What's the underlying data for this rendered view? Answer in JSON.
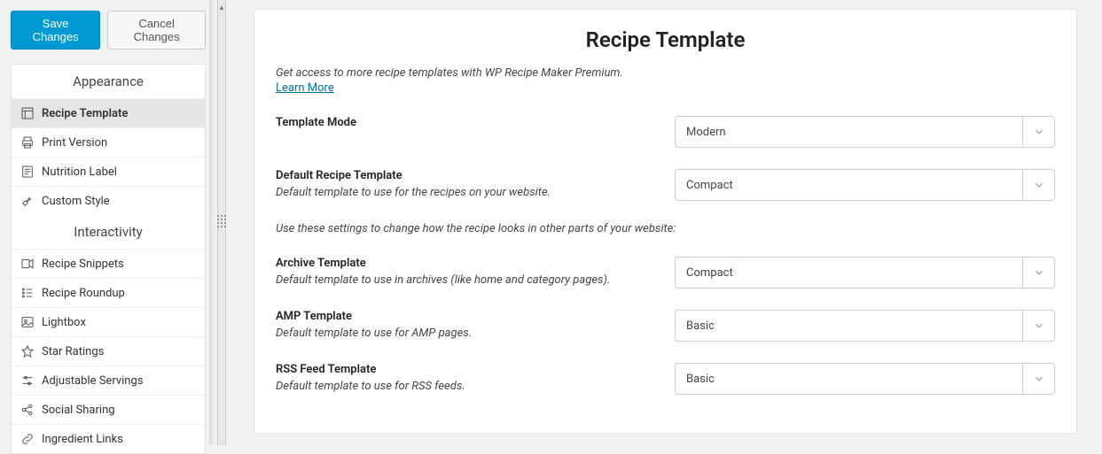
{
  "buttons": {
    "save": "Save Changes",
    "cancel": "Cancel Changes"
  },
  "sidebar": {
    "section_appearance": "Appearance",
    "section_interactivity": "Interactivity",
    "appearance_items": [
      {
        "label": "Recipe Template"
      },
      {
        "label": "Print Version"
      },
      {
        "label": "Nutrition Label"
      },
      {
        "label": "Custom Style"
      }
    ],
    "interactivity_items": [
      {
        "label": "Recipe Snippets"
      },
      {
        "label": "Recipe Roundup"
      },
      {
        "label": "Lightbox"
      },
      {
        "label": "Star Ratings"
      },
      {
        "label": "Adjustable Servings"
      },
      {
        "label": "Social Sharing"
      },
      {
        "label": "Ingredient Links"
      }
    ]
  },
  "main": {
    "title": "Recipe Template",
    "promo": "Get access to more recipe templates with WP Recipe Maker Premium.",
    "learn_more": "Learn More",
    "intersettings_note": "Use these settings to change how the recipe looks in other parts of your website:",
    "fields": {
      "template_mode": {
        "label": "Template Mode",
        "value": "Modern"
      },
      "default_template": {
        "label": "Default Recipe Template",
        "desc": "Default template to use for the recipes on your website.",
        "value": "Compact"
      },
      "archive_template": {
        "label": "Archive Template",
        "desc": "Default template to use in archives (like home and category pages).",
        "value": "Compact"
      },
      "amp_template": {
        "label": "AMP Template",
        "desc": "Default template to use for AMP pages.",
        "value": "Basic"
      },
      "rss_template": {
        "label": "RSS Feed Template",
        "desc": "Default template to use for RSS feeds.",
        "value": "Basic"
      }
    }
  }
}
